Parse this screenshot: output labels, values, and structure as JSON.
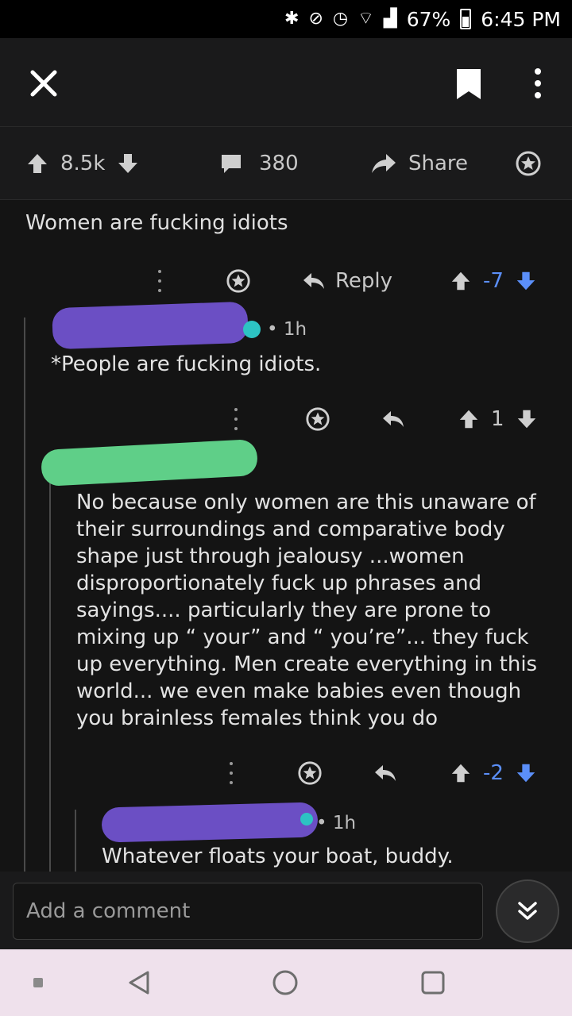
{
  "status_bar": {
    "battery": "67%",
    "time": "6:45 PM"
  },
  "post": {
    "votes": "8.5k",
    "comments": "380",
    "share_label": "Share",
    "body": "Women are fucking idiots",
    "body_actions": {
      "reply_label": "Reply",
      "votes": "-7"
    }
  },
  "comments": [
    {
      "time": "1h",
      "text": "*People are fucking idiots.",
      "votes": "1"
    },
    {
      "text": "No because only women are this unaware of their surroundings and comparative body shape just through jealousy ...women disproportionately fuck up phrases and sayings.... particularly they are prone to mixing up “ your” and “ you’re”... they fuck up everything. Men create everything in this world... we even make babies even though you brainless females think you do",
      "votes": "-2"
    },
    {
      "time": "1h",
      "text": "Whatever floats your boat, buddy."
    }
  ],
  "composer": {
    "placeholder": "Add a comment"
  },
  "colors": {
    "upvote": "#d0d0d0",
    "downvote": "#5b8ff9",
    "redact_purple": "#6b4fc4",
    "redact_green": "#5fcf88",
    "accent_teal": "#2dc3c3"
  }
}
